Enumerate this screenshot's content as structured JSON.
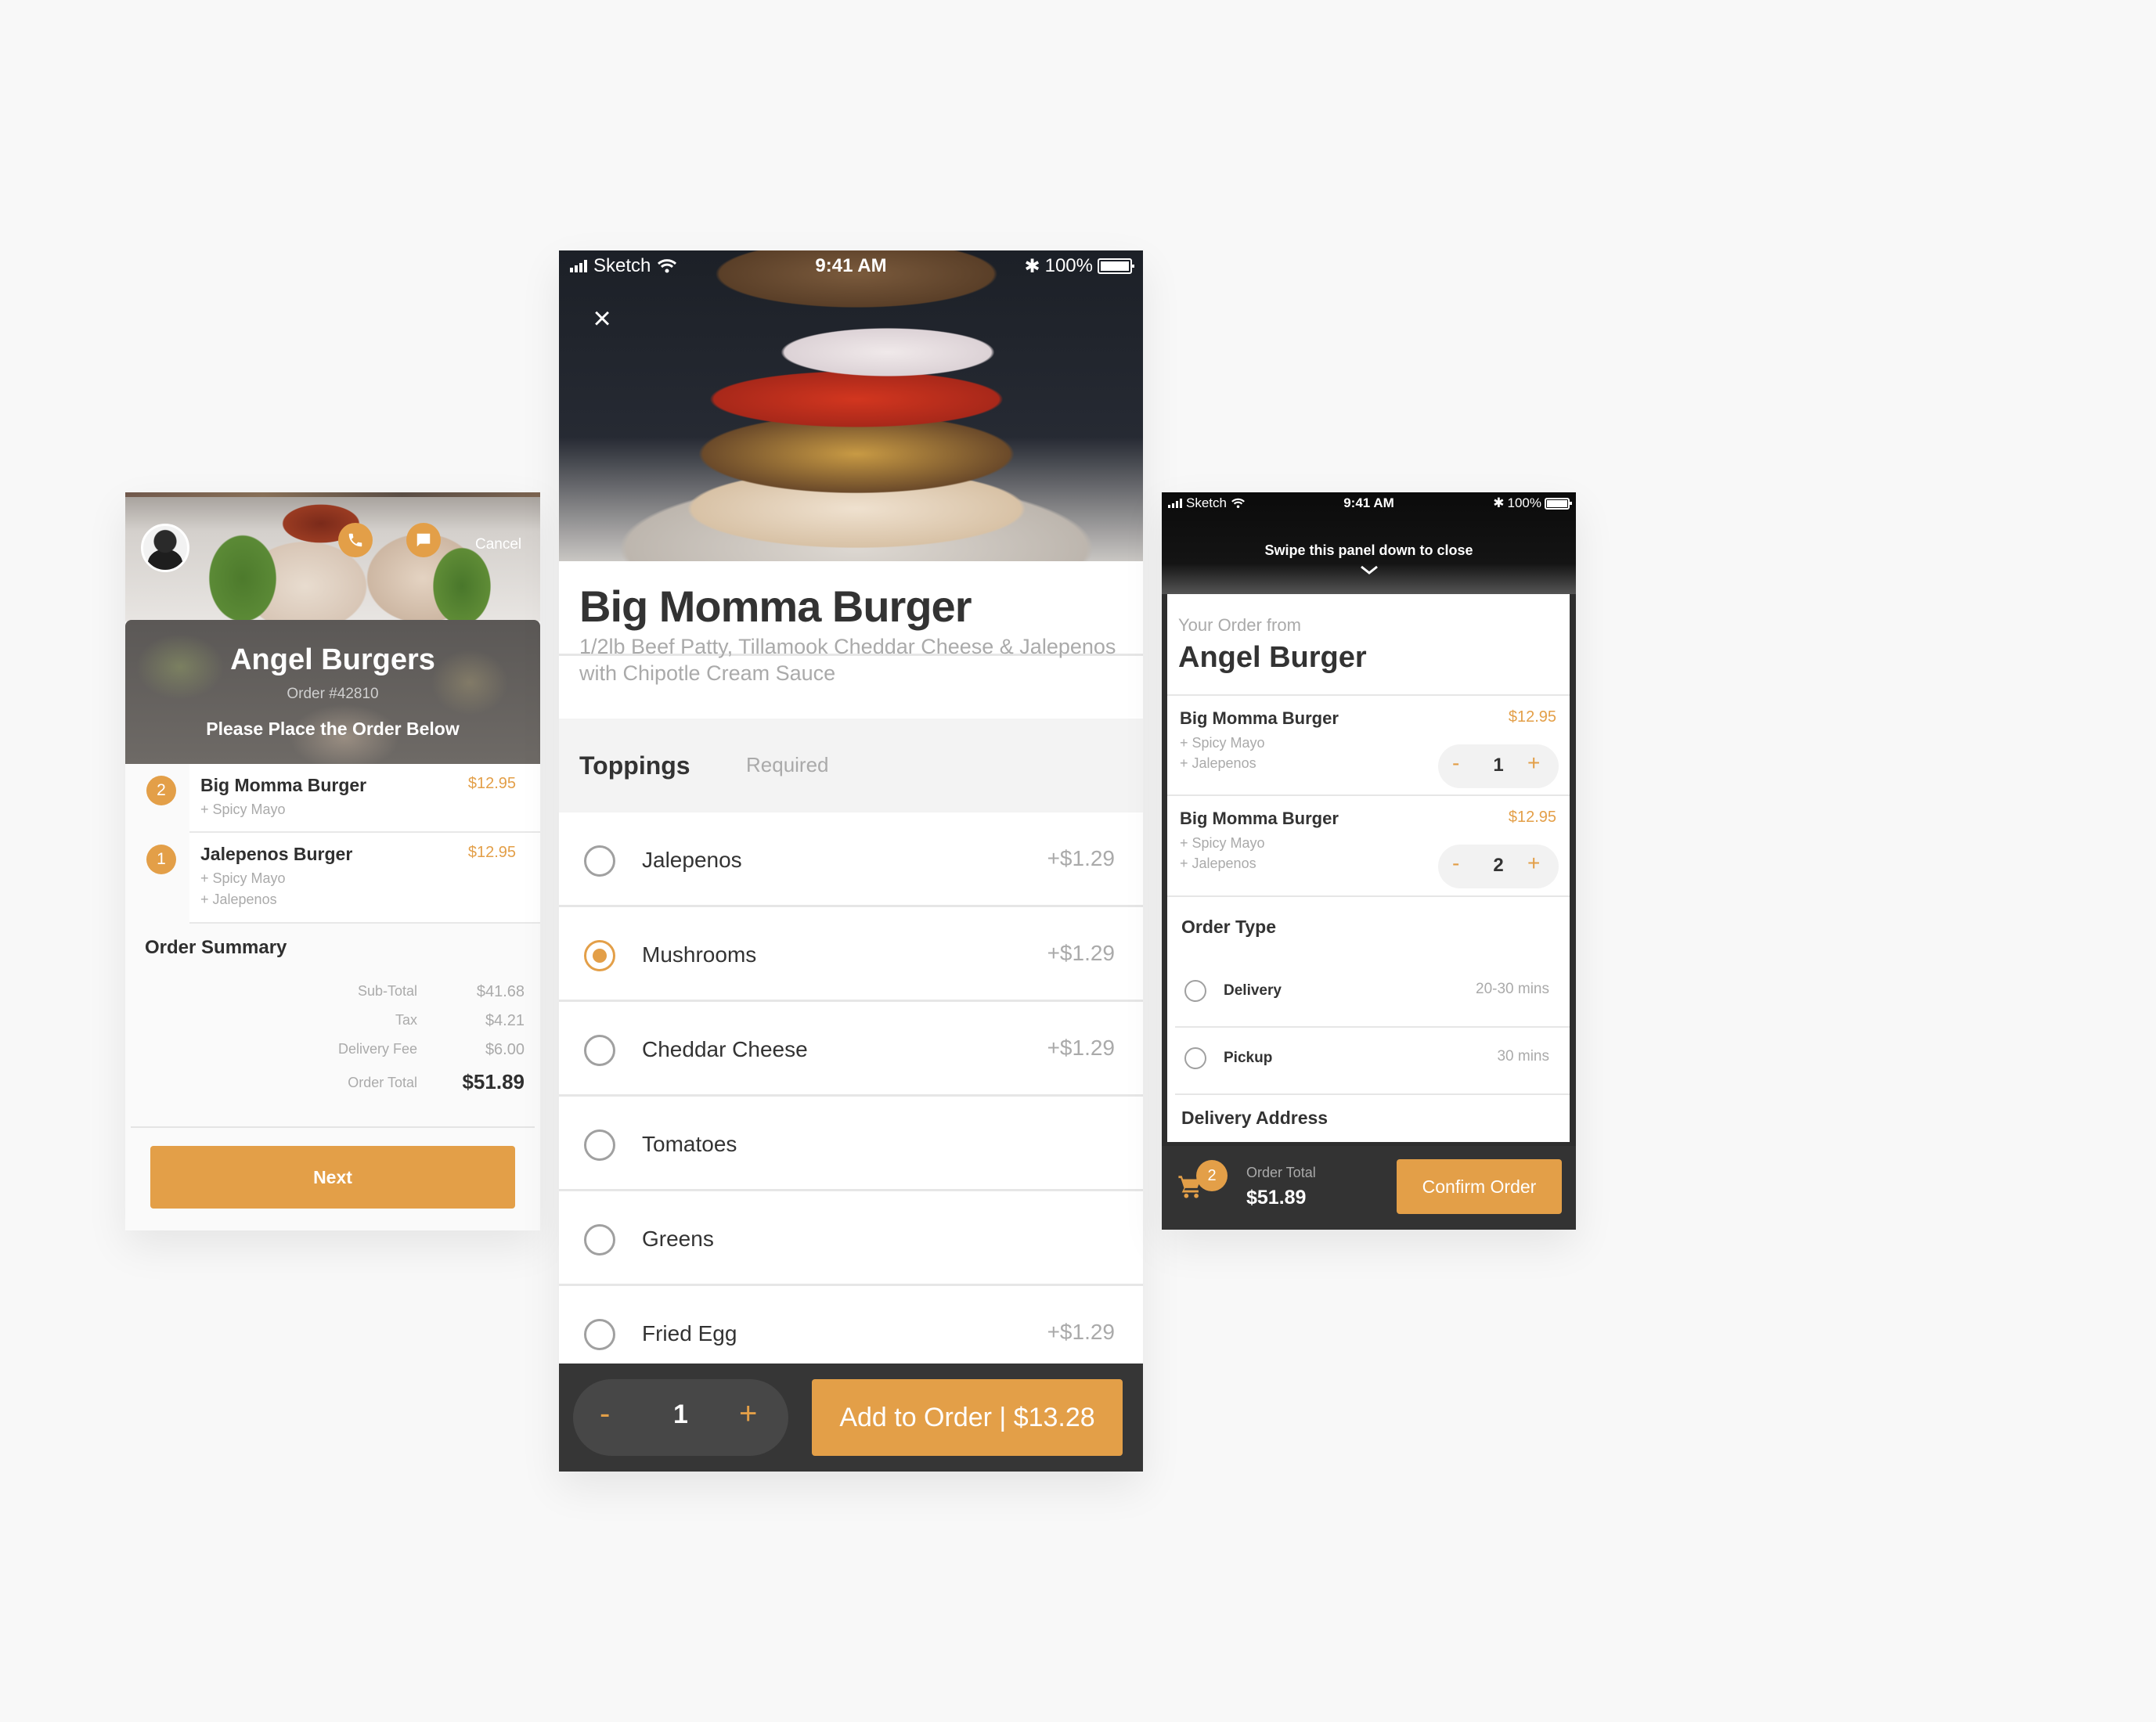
{
  "theme": {
    "accent": "#e39f48",
    "dark_bar": "#363636",
    "text_dark": "#333333",
    "text_muted": "#aaaaaa",
    "background": "#f8f8f8"
  },
  "left_screen": {
    "header": {
      "avatar_icon": "user-avatar",
      "call_icon": "phone-icon",
      "message_icon": "chat-bubble-icon",
      "cancel_label": "Cancel"
    },
    "banner": {
      "restaurant": "Angel Burgers",
      "order_number": "Order #42810",
      "instruction": "Please Place the Order Below"
    },
    "cart_items": [
      {
        "qty": "2",
        "name": "Big Momma Burger",
        "price": "$12.95",
        "modifiers": [
          "+ Spicy Mayo"
        ]
      },
      {
        "qty": "1",
        "name": "Jalepenos Burger",
        "price": "$12.95",
        "modifiers": [
          "+ Spicy Mayo",
          "+ Jalepenos"
        ]
      }
    ],
    "summary": {
      "title": "Order Summary",
      "rows": [
        {
          "label": "Sub-Total",
          "value": "$41.68"
        },
        {
          "label": "Tax",
          "value": "$4.21"
        },
        {
          "label": "Delivery Fee",
          "value": "$6.00"
        },
        {
          "label": "Order Total",
          "value": "$51.89"
        }
      ]
    },
    "next_label": "Next"
  },
  "center_screen": {
    "status_bar": {
      "carrier": "Sketch",
      "time": "9:41 AM",
      "battery": "100%",
      "battery_level": 1.0
    },
    "close_icon": "×",
    "product": {
      "title": "Big Momma Burger",
      "description": "1/2lb Beef Patty, Tillamook Cheddar Cheese & Jalepenos with Chipotle Cream Sauce"
    },
    "section": {
      "title": "Toppings",
      "tag": "Required"
    },
    "options": [
      {
        "label": "Jalepenos",
        "price": "+$1.29",
        "selected": false
      },
      {
        "label": "Mushrooms",
        "price": "+$1.29",
        "selected": true
      },
      {
        "label": "Cheddar Cheese",
        "price": "+$1.29",
        "selected": false
      },
      {
        "label": "Tomatoes",
        "price": "",
        "selected": false
      },
      {
        "label": "Greens",
        "price": "",
        "selected": false
      },
      {
        "label": "Fried Egg",
        "price": "+$1.29",
        "selected": false
      }
    ],
    "stepper": {
      "minus": "-",
      "value": "1",
      "plus": "+"
    },
    "add_button": "Add to Order |  $13.28"
  },
  "right_screen": {
    "status_bar": {
      "carrier": "Sketch",
      "time": "9:41 AM",
      "battery": "100%",
      "battery_level": 1.0
    },
    "swipe_hint": "Swipe this panel down to close",
    "subtitle": "Your Order from",
    "title": "Angel Burger",
    "items": [
      {
        "name": "Big Momma Burger",
        "price": "$12.95",
        "modifiers": [
          "+ Spicy Mayo",
          "+ Jalepenos"
        ],
        "qty": "1"
      },
      {
        "name": "Big Momma Burger",
        "price": "$12.95",
        "modifiers": [
          "+ Spicy Mayo",
          "+ Jalepenos"
        ],
        "qty": "2"
      }
    ],
    "stepper_minus": "-",
    "stepper_plus": "+",
    "order_type": {
      "title": "Order Type",
      "options": [
        {
          "label": "Delivery",
          "eta": "20-30 mins",
          "selected": false
        },
        {
          "label": "Pickup",
          "eta": "30 mins",
          "selected": false
        }
      ]
    },
    "delivery_address_title": "Delivery Address",
    "footer": {
      "cart_count": "2",
      "total_label": "Order Total",
      "total": "$51.89",
      "confirm_label": "Confirm Order"
    }
  }
}
